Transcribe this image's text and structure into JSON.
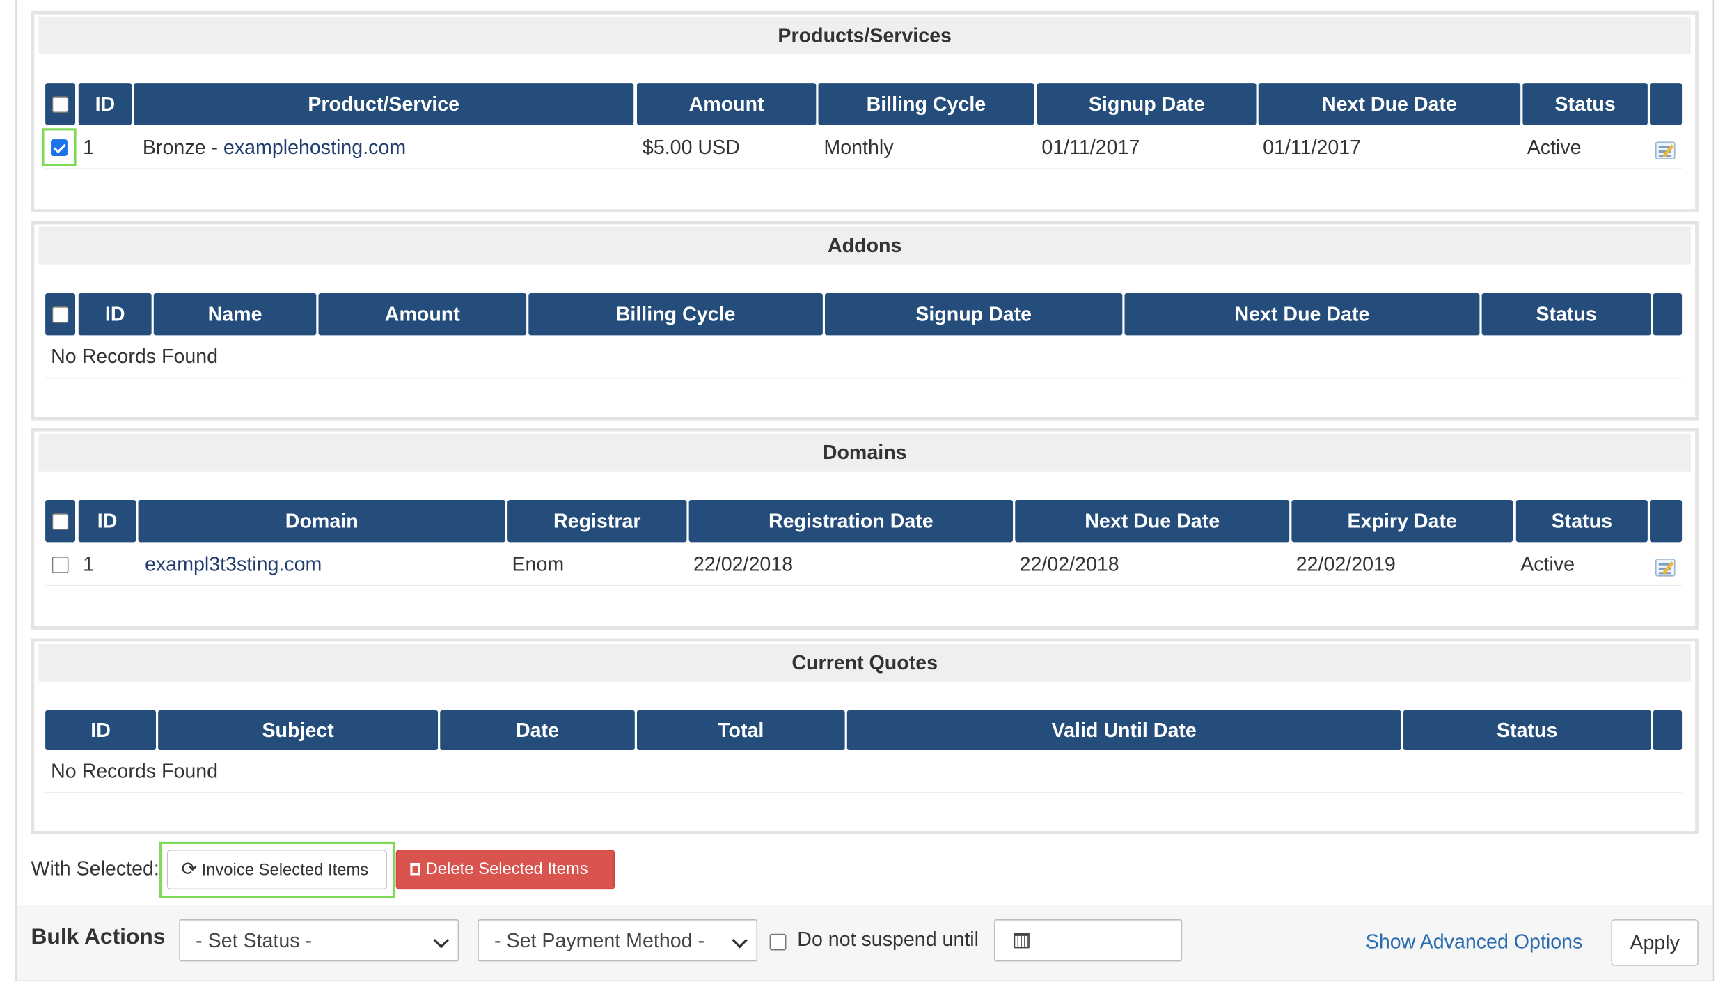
{
  "products": {
    "title": "Products/Services",
    "columns": [
      "ID",
      "Product/Service",
      "Amount",
      "Billing Cycle",
      "Signup Date",
      "Next Due Date",
      "Status"
    ],
    "rows": [
      {
        "id": "1",
        "product_prefix": "Bronze - ",
        "product_link": "examplehosting.com",
        "amount": "$5.00 USD",
        "billing_cycle": "Monthly",
        "signup_date": "01/11/2017",
        "next_due_date": "01/11/2017",
        "status": "Active",
        "checked": true,
        "icon": "edit-icon"
      }
    ]
  },
  "addons": {
    "title": "Addons",
    "columns": [
      "ID",
      "Name",
      "Amount",
      "Billing Cycle",
      "Signup Date",
      "Next Due Date",
      "Status"
    ],
    "empty_text": "No Records Found"
  },
  "domains": {
    "title": "Domains",
    "columns": [
      "ID",
      "Domain",
      "Registrar",
      "Registration Date",
      "Next Due Date",
      "Expiry Date",
      "Status"
    ],
    "rows": [
      {
        "id": "1",
        "domain": "exampl3t3sting.com",
        "registrar": "Enom",
        "registration_date": "22/02/2018",
        "next_due_date": "22/02/2018",
        "expiry_date": "22/02/2019",
        "status": "Active",
        "checked": false,
        "icon": "edit-icon"
      }
    ]
  },
  "quotes": {
    "title": "Current Quotes",
    "columns": [
      "ID",
      "Subject",
      "Date",
      "Total",
      "Valid Until Date",
      "Status"
    ],
    "empty_text": "No Records Found"
  },
  "with_selected": {
    "label": "With Selected:",
    "invoice_button": "Invoice Selected Items",
    "invoice_icon": "refresh-icon",
    "delete_button": "Delete Selected Items",
    "delete_icon": "trash-icon"
  },
  "bulk_actions": {
    "label": "Bulk Actions",
    "status_select": "- Set Status -",
    "payment_select": "- Set Payment Method -",
    "suspend_label": "Do not suspend until",
    "suspend_checked": false,
    "date_icon": "calendar-icon",
    "advanced_link": "Show Advanced Options",
    "apply_button": "Apply"
  },
  "colors": {
    "header_bg": "#244d7b",
    "highlight": "#7ed957",
    "danger": "#d9534f",
    "link": "#2a6ab0"
  }
}
